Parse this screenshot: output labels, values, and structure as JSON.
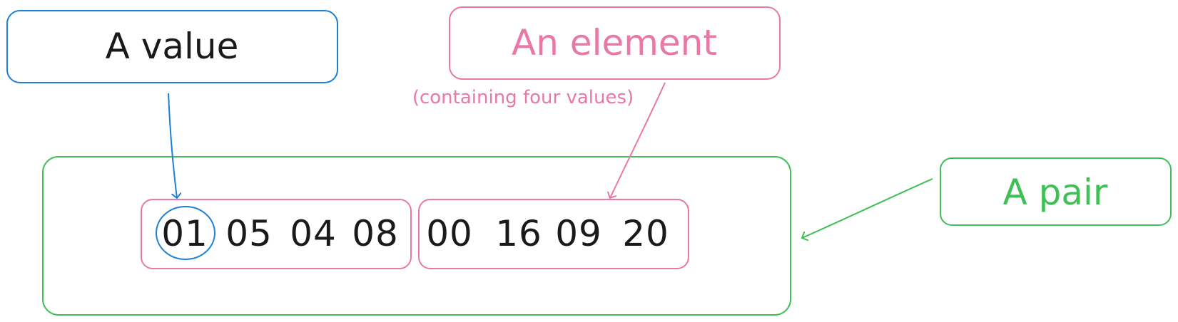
{
  "colors": {
    "value": "#1e7fd6",
    "element": "#e879a6",
    "pair": "#3fbf55",
    "text": "#1a1a1a"
  },
  "labels": {
    "value": "A value",
    "element": "An element",
    "element_note": "(containing four values)",
    "pair": "A pair"
  },
  "pair": {
    "element_1": [
      "01",
      "05",
      "04",
      "08"
    ],
    "element_2": [
      "00",
      "16",
      "09",
      "20"
    ]
  }
}
